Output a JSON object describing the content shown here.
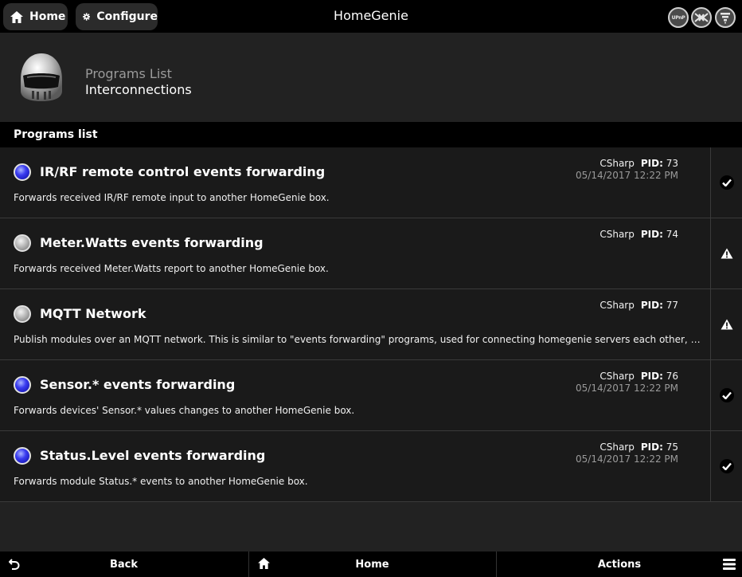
{
  "app": {
    "title": "HomeGenie"
  },
  "toolbar": {
    "home_label": "Home",
    "configure_label": "Configure",
    "upnp_label": "UPnP"
  },
  "breadcrumb": {
    "parent": "Programs List",
    "current": "Interconnections"
  },
  "section": {
    "title": "Programs list"
  },
  "programs": [
    {
      "name": "IR/RF remote control events forwarding",
      "description": "Forwards received IR/RF remote input to another HomeGenie box.",
      "language": "CSharp",
      "pid_label": "PID:",
      "pid": "73",
      "date": "05/14/2017 12:22 PM",
      "status": "on",
      "side_icon": "check-icon"
    },
    {
      "name": "Meter.Watts events forwarding",
      "description": "Forwards received Meter.Watts report to another HomeGenie box.",
      "language": "CSharp",
      "pid_label": "PID:",
      "pid": "74",
      "date": "",
      "status": "off",
      "side_icon": "warning-icon"
    },
    {
      "name": "MQTT Network",
      "description": "Publish modules over an MQTT network. This is similar to \"events forwarding\" programs, used for connecting homegenie servers each other, but it relays on an...",
      "language": "CSharp",
      "pid_label": "PID:",
      "pid": "77",
      "date": "",
      "status": "off",
      "side_icon": "warning-icon"
    },
    {
      "name": "Sensor.* events forwarding",
      "description": "Forwards devices' Sensor.* values changes to another HomeGenie box.",
      "language": "CSharp",
      "pid_label": "PID:",
      "pid": "76",
      "date": "05/14/2017 12:22 PM",
      "status": "on",
      "side_icon": "check-icon"
    },
    {
      "name": "Status.Level events forwarding",
      "description": "Forwards module Status.* events to another HomeGenie box.",
      "language": "CSharp",
      "pid_label": "PID:",
      "pid": "75",
      "date": "05/14/2017 12:22 PM",
      "status": "on",
      "side_icon": "check-icon"
    }
  ],
  "bottombar": {
    "back_label": "Back",
    "home_label": "Home",
    "actions_label": "Actions"
  },
  "colors": {
    "led_on": "#2b2cf0",
    "led_off": "#b8b8b8",
    "background": "#222222",
    "bar": "#000000"
  }
}
